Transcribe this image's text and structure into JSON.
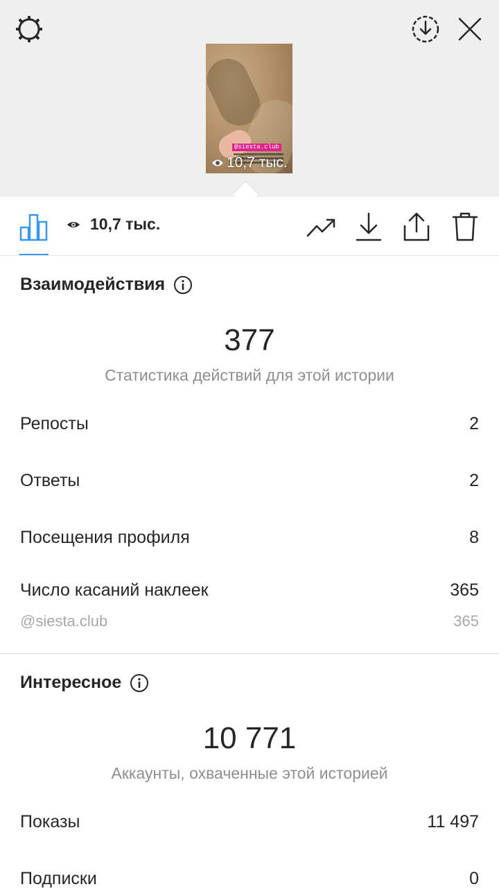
{
  "story": {
    "sticker_tag": "@siesta.club",
    "views": "10,7 тыс."
  },
  "toolbar": {
    "views": "10,7 тыс."
  },
  "interactions": {
    "title": "Взаимодействия",
    "total": "377",
    "subtitle": "Статистика действий для этой истории",
    "rows": [
      {
        "label": "Репосты",
        "value": "2"
      },
      {
        "label": "Ответы",
        "value": "2"
      },
      {
        "label": "Посещения профиля",
        "value": "8"
      },
      {
        "label": "Число касаний наклеек",
        "value": "365"
      }
    ],
    "sticker": {
      "label": "@siesta.club",
      "value": "365"
    }
  },
  "discovery": {
    "title": "Интересное",
    "total": "10 771",
    "subtitle": "Аккаунты, охваченные этой историей",
    "rows": [
      {
        "label": "Показы",
        "value": "11 497"
      },
      {
        "label": "Подписки",
        "value": "0"
      }
    ]
  },
  "colors": {
    "accent": "#3897f0",
    "sticker_tag": "#e0218a",
    "top_background": "#efefef"
  }
}
